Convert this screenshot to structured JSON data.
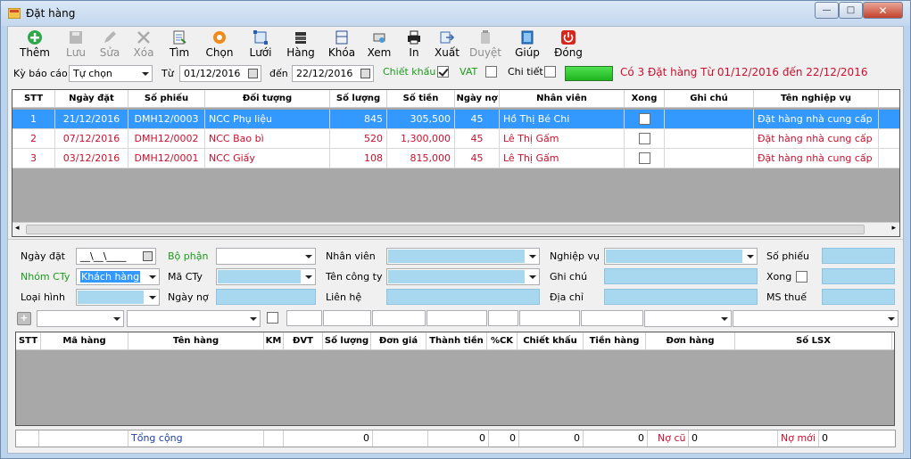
{
  "window": {
    "title": "Đặt hàng"
  },
  "toolbar": {
    "them": "Thêm",
    "luu": "Lưu",
    "sua": "Sửa",
    "xoa": "Xóa",
    "tim": "Tìm",
    "chon": "Chọn",
    "luoi": "Lưới",
    "hang": "Hàng",
    "khoa": "Khóa",
    "xem": "Xem",
    "in": "In",
    "xuat": "Xuất",
    "duyet": "Duyệt",
    "giup": "Giúp",
    "dong": "Đóng"
  },
  "filter": {
    "ky_bao_cao_label": "Kỳ báo cáo",
    "ky_bao_cao_value": "Tự chọn",
    "tu_label": "Từ",
    "tu_value": "01/12/2016",
    "den_label": "đến",
    "den_value": "22/12/2016",
    "chiet_khau_label": "Chiết khấu",
    "vat_label": "VAT",
    "chi_tiet_label": "Chi tiết",
    "status": "Có 3 Đặt hàng Từ 01/12/2016 đến 22/12/2016"
  },
  "grid": {
    "columns": [
      "STT",
      "Ngày đặt",
      "Số phiếu",
      "Đối tượng",
      "Số lượng",
      "Số tiền",
      "Ngày nợ",
      "Nhân viên",
      "Xong",
      "Ghi chú",
      "Tên nghiệp vụ"
    ],
    "rows": [
      {
        "stt": "1",
        "ngay": "21/12/2016",
        "so_phieu": "DMH12/0003",
        "doi_tuong": "NCC Phụ liệu",
        "so_luong": "845",
        "so_tien": "305,500",
        "ngay_no": "45",
        "nhan_vien": "Hồ Thị Bé Chi",
        "ghi_chu": "",
        "nghiep_vu": "Đặt hàng nhà cung cấp"
      },
      {
        "stt": "2",
        "ngay": "07/12/2016",
        "so_phieu": "DMH12/0002",
        "doi_tuong": "NCC Bao bì",
        "so_luong": "520",
        "so_tien": "1,300,000",
        "ngay_no": "45",
        "nhan_vien": "Lê Thị Gấm",
        "ghi_chu": "",
        "nghiep_vu": "Đặt hàng nhà cung cấp"
      },
      {
        "stt": "3",
        "ngay": "03/12/2016",
        "so_phieu": "DMH12/0001",
        "doi_tuong": "NCC Giấy",
        "so_luong": "108",
        "so_tien": "815,000",
        "ngay_no": "45",
        "nhan_vien": "Lê Thị Gấm",
        "ghi_chu": "",
        "nghiep_vu": "Đặt hàng nhà cung cấp"
      }
    ]
  },
  "form": {
    "ngay_dat_label": "Ngày đặt",
    "ngay_dat_value": "__\\__\\____",
    "bo_phan_label": "Bộ phận",
    "nhan_vien_label": "Nhân viên",
    "nghiep_vu_label": "Nghiệp vụ",
    "so_phieu_label": "Số phiếu",
    "nhom_cty_label": "Nhóm CTy",
    "nhom_cty_value": "Khách hàng",
    "ma_cty_label": "Mã CTy",
    "ten_cong_ty_label": "Tên công ty",
    "ghi_chu_label": "Ghi chú",
    "xong_label": "Xong",
    "loai_hinh_label": "Loại hình",
    "ngay_no_label": "Ngày nợ",
    "lien_he_label": "Liên hệ",
    "dia_chi_label": "Địa chỉ",
    "ms_thue_label": "MS thuế"
  },
  "detail": {
    "columns": [
      "STT",
      "Mã hàng",
      "Tên hàng",
      "KM",
      "ĐVT",
      "Số lượng",
      "Đơn giá",
      "Thành tiền",
      "%CK",
      "Chiết khấu",
      "Tiền hàng",
      "Đơn hàng",
      "Số LSX"
    ]
  },
  "footer": {
    "tong_cong": "Tổng cộng",
    "so_luong": "0",
    "thanh_tien": "0",
    "ck": "0",
    "chiet_khau": "0",
    "tien_hang": "0",
    "no_cu_label": "Nợ cũ",
    "no_cu": "0",
    "no_moi_label": "Nợ mới",
    "no_moi": "0"
  }
}
